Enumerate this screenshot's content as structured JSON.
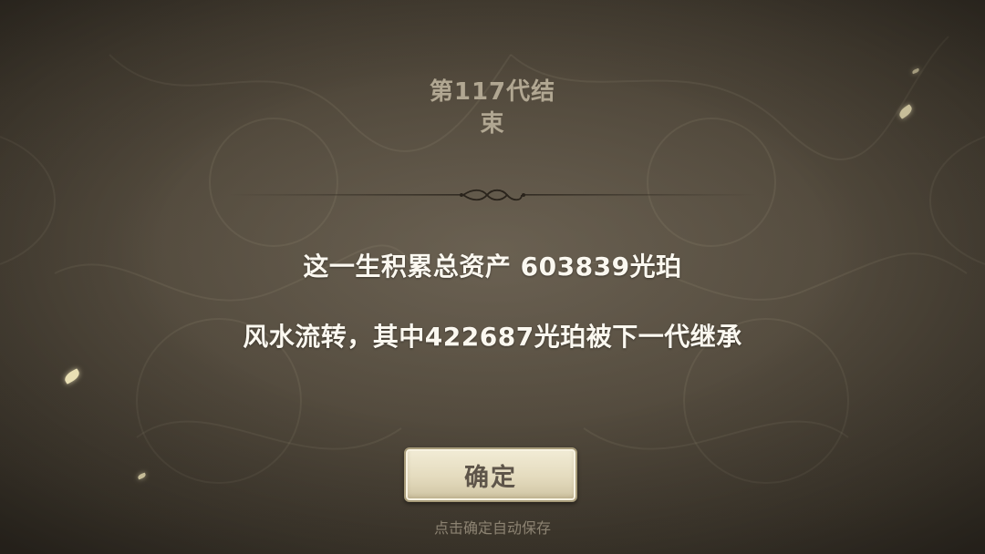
{
  "dialog": {
    "title": "第117代结束",
    "title_line1": "第117代结",
    "title_line2": "束",
    "message_total": "这一生积累总资产 603839光珀",
    "message_inherit": "风水流转，其中422687光珀被下一代继承",
    "confirm_label": "确定",
    "hint": "点击确定自动保存"
  },
  "icons": {
    "divider": "ornate-scroll-divider-icon",
    "petals": "falling-petal-icon"
  },
  "colors": {
    "background": "#4a4236",
    "title": "#b1a792",
    "message": "#fbf8f0",
    "button_face": "#e4dbbe",
    "button_text": "#5e554a",
    "hint": "#8c8372"
  }
}
